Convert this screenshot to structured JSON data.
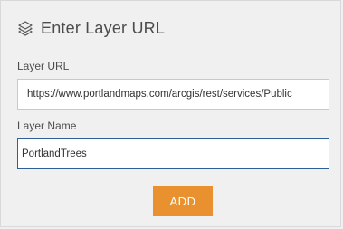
{
  "header": {
    "icon": "layers-icon",
    "title": "Enter Layer URL"
  },
  "form": {
    "url_label": "Layer URL",
    "url_value": "https://www.portlandmaps.com/arcgis/rest/services/Public",
    "name_label": "Layer Name",
    "name_value": "PortlandTrees"
  },
  "actions": {
    "add_label": "ADD"
  },
  "colors": {
    "accent": "#e8912e",
    "focus_border": "#2f5f98"
  }
}
